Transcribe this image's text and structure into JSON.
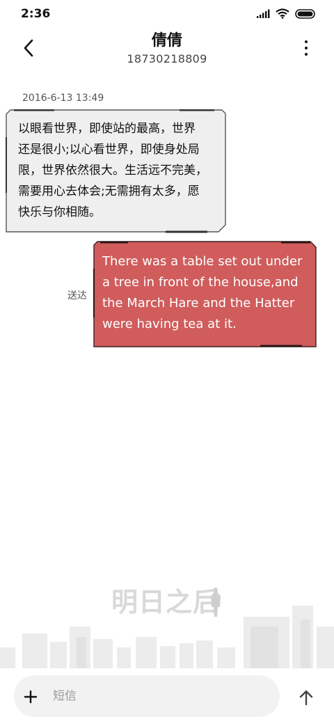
{
  "status_bar": {
    "time": "2:36",
    "icons": [
      "signal-icon",
      "wifi-icon",
      "battery-icon"
    ]
  },
  "header": {
    "name": "倩倩",
    "number": "18730218809",
    "back_icon": "back-arrow-icon",
    "more_icon": "more-vertical-icon"
  },
  "messages": {
    "timestamp": "2016-6-13 13:49",
    "received": {
      "lines": [
        "以眼看世界，即使站的最高，世界",
        "还是很小;以心看世界，即使身处局",
        "限，世界依然很大。生活远不完美，",
        "需要用心去体会;无需拥有太多，愿",
        "快乐与你相随。"
      ],
      "bubble_color": "#efefef"
    },
    "sent": {
      "lines": [
        "There was a table set out under",
        "a tree in front of the house,and",
        "the March Hare and the Hatter",
        "were having tea at it."
      ],
      "status": "送达",
      "bubble_color": "#d05c5c"
    }
  },
  "watermark": {
    "text": "明日之后"
  },
  "composer": {
    "placeholder": "短信",
    "add_icon": "plus-icon",
    "send_icon": "arrow-up-icon"
  },
  "colors": {
    "accent": "#d05c5c",
    "background": "#ffffff",
    "received_bubble": "#efefef"
  }
}
